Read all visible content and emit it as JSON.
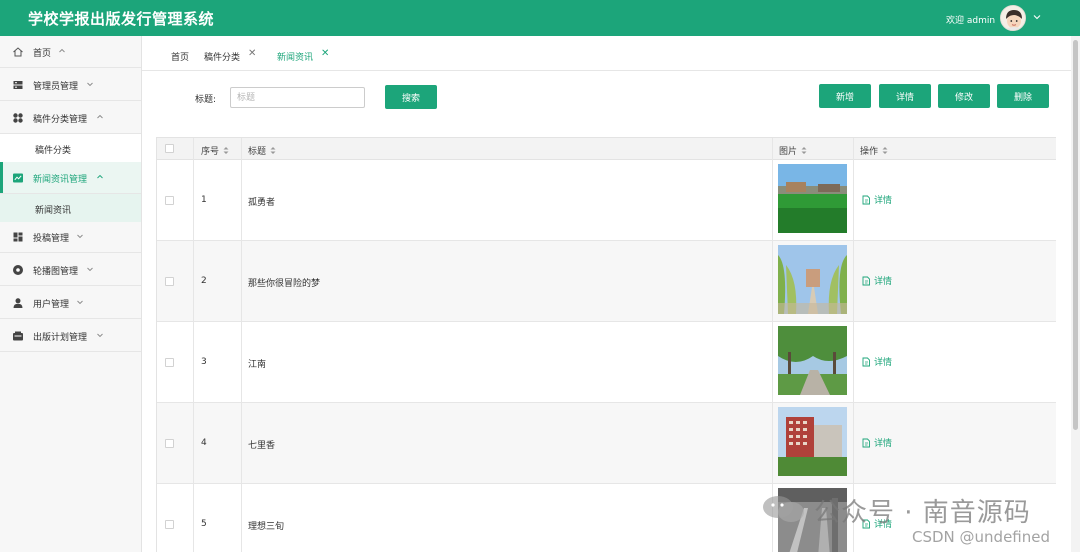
{
  "header": {
    "title": "学校学报出版发行管理系统",
    "welcome": "欢迎 admin",
    "bg_color": "#1ca57a"
  },
  "sidebar": {
    "items": [
      {
        "label": "首页",
        "icon": "home-icon",
        "expanded": true
      },
      {
        "label": "管理员管理",
        "icon": "admin-icon",
        "expanded": false
      },
      {
        "label": "稿件分类管理",
        "icon": "category-icon",
        "expanded": true
      },
      {
        "label": "稿件分类",
        "sub": true
      },
      {
        "label": "新闻资讯管理",
        "icon": "news-icon",
        "expanded": true,
        "active": true
      },
      {
        "label": "新闻资讯",
        "sub": true,
        "active": true
      },
      {
        "label": "投稿管理",
        "icon": "submission-icon",
        "expanded": false
      },
      {
        "label": "轮播图管理",
        "icon": "carousel-icon",
        "expanded": false
      },
      {
        "label": "用户管理",
        "icon": "user-icon",
        "expanded": false
      },
      {
        "label": "出版计划管理",
        "icon": "plan-icon",
        "expanded": false
      }
    ]
  },
  "tabs": [
    {
      "label": "首页",
      "closable": false
    },
    {
      "label": "稿件分类",
      "closable": true,
      "close": "✕"
    },
    {
      "label": "新闻资讯",
      "closable": true,
      "active": true,
      "close": "✕"
    }
  ],
  "search": {
    "label": "标题:",
    "placeholder": "标题",
    "value": "",
    "button": "搜索"
  },
  "actions": {
    "add": "新增",
    "detail": "详情",
    "edit": "修改",
    "delete": "删除"
  },
  "table": {
    "columns": [
      "序号",
      "标题",
      "图片",
      "操作"
    ],
    "rows": [
      {
        "index": "1",
        "title": "孤勇者",
        "action": "详情",
        "image": "campus-lawn"
      },
      {
        "index": "2",
        "title": "那些你很冒险的梦",
        "action": "详情",
        "image": "tree-avenue"
      },
      {
        "index": "3",
        "title": "江南",
        "action": "详情",
        "image": "campus-path"
      },
      {
        "index": "4",
        "title": "七里香",
        "action": "详情",
        "image": "red-building"
      },
      {
        "index": "5",
        "title": "理想三旬",
        "action": "详情",
        "image": "stairs-interior"
      }
    ]
  },
  "watermark": {
    "text": "公众号 · 南音源码",
    "sub": "CSDN @undefined"
  },
  "colors": {
    "accent": "#1ca57a",
    "accent_light": "#e6f4ef"
  }
}
